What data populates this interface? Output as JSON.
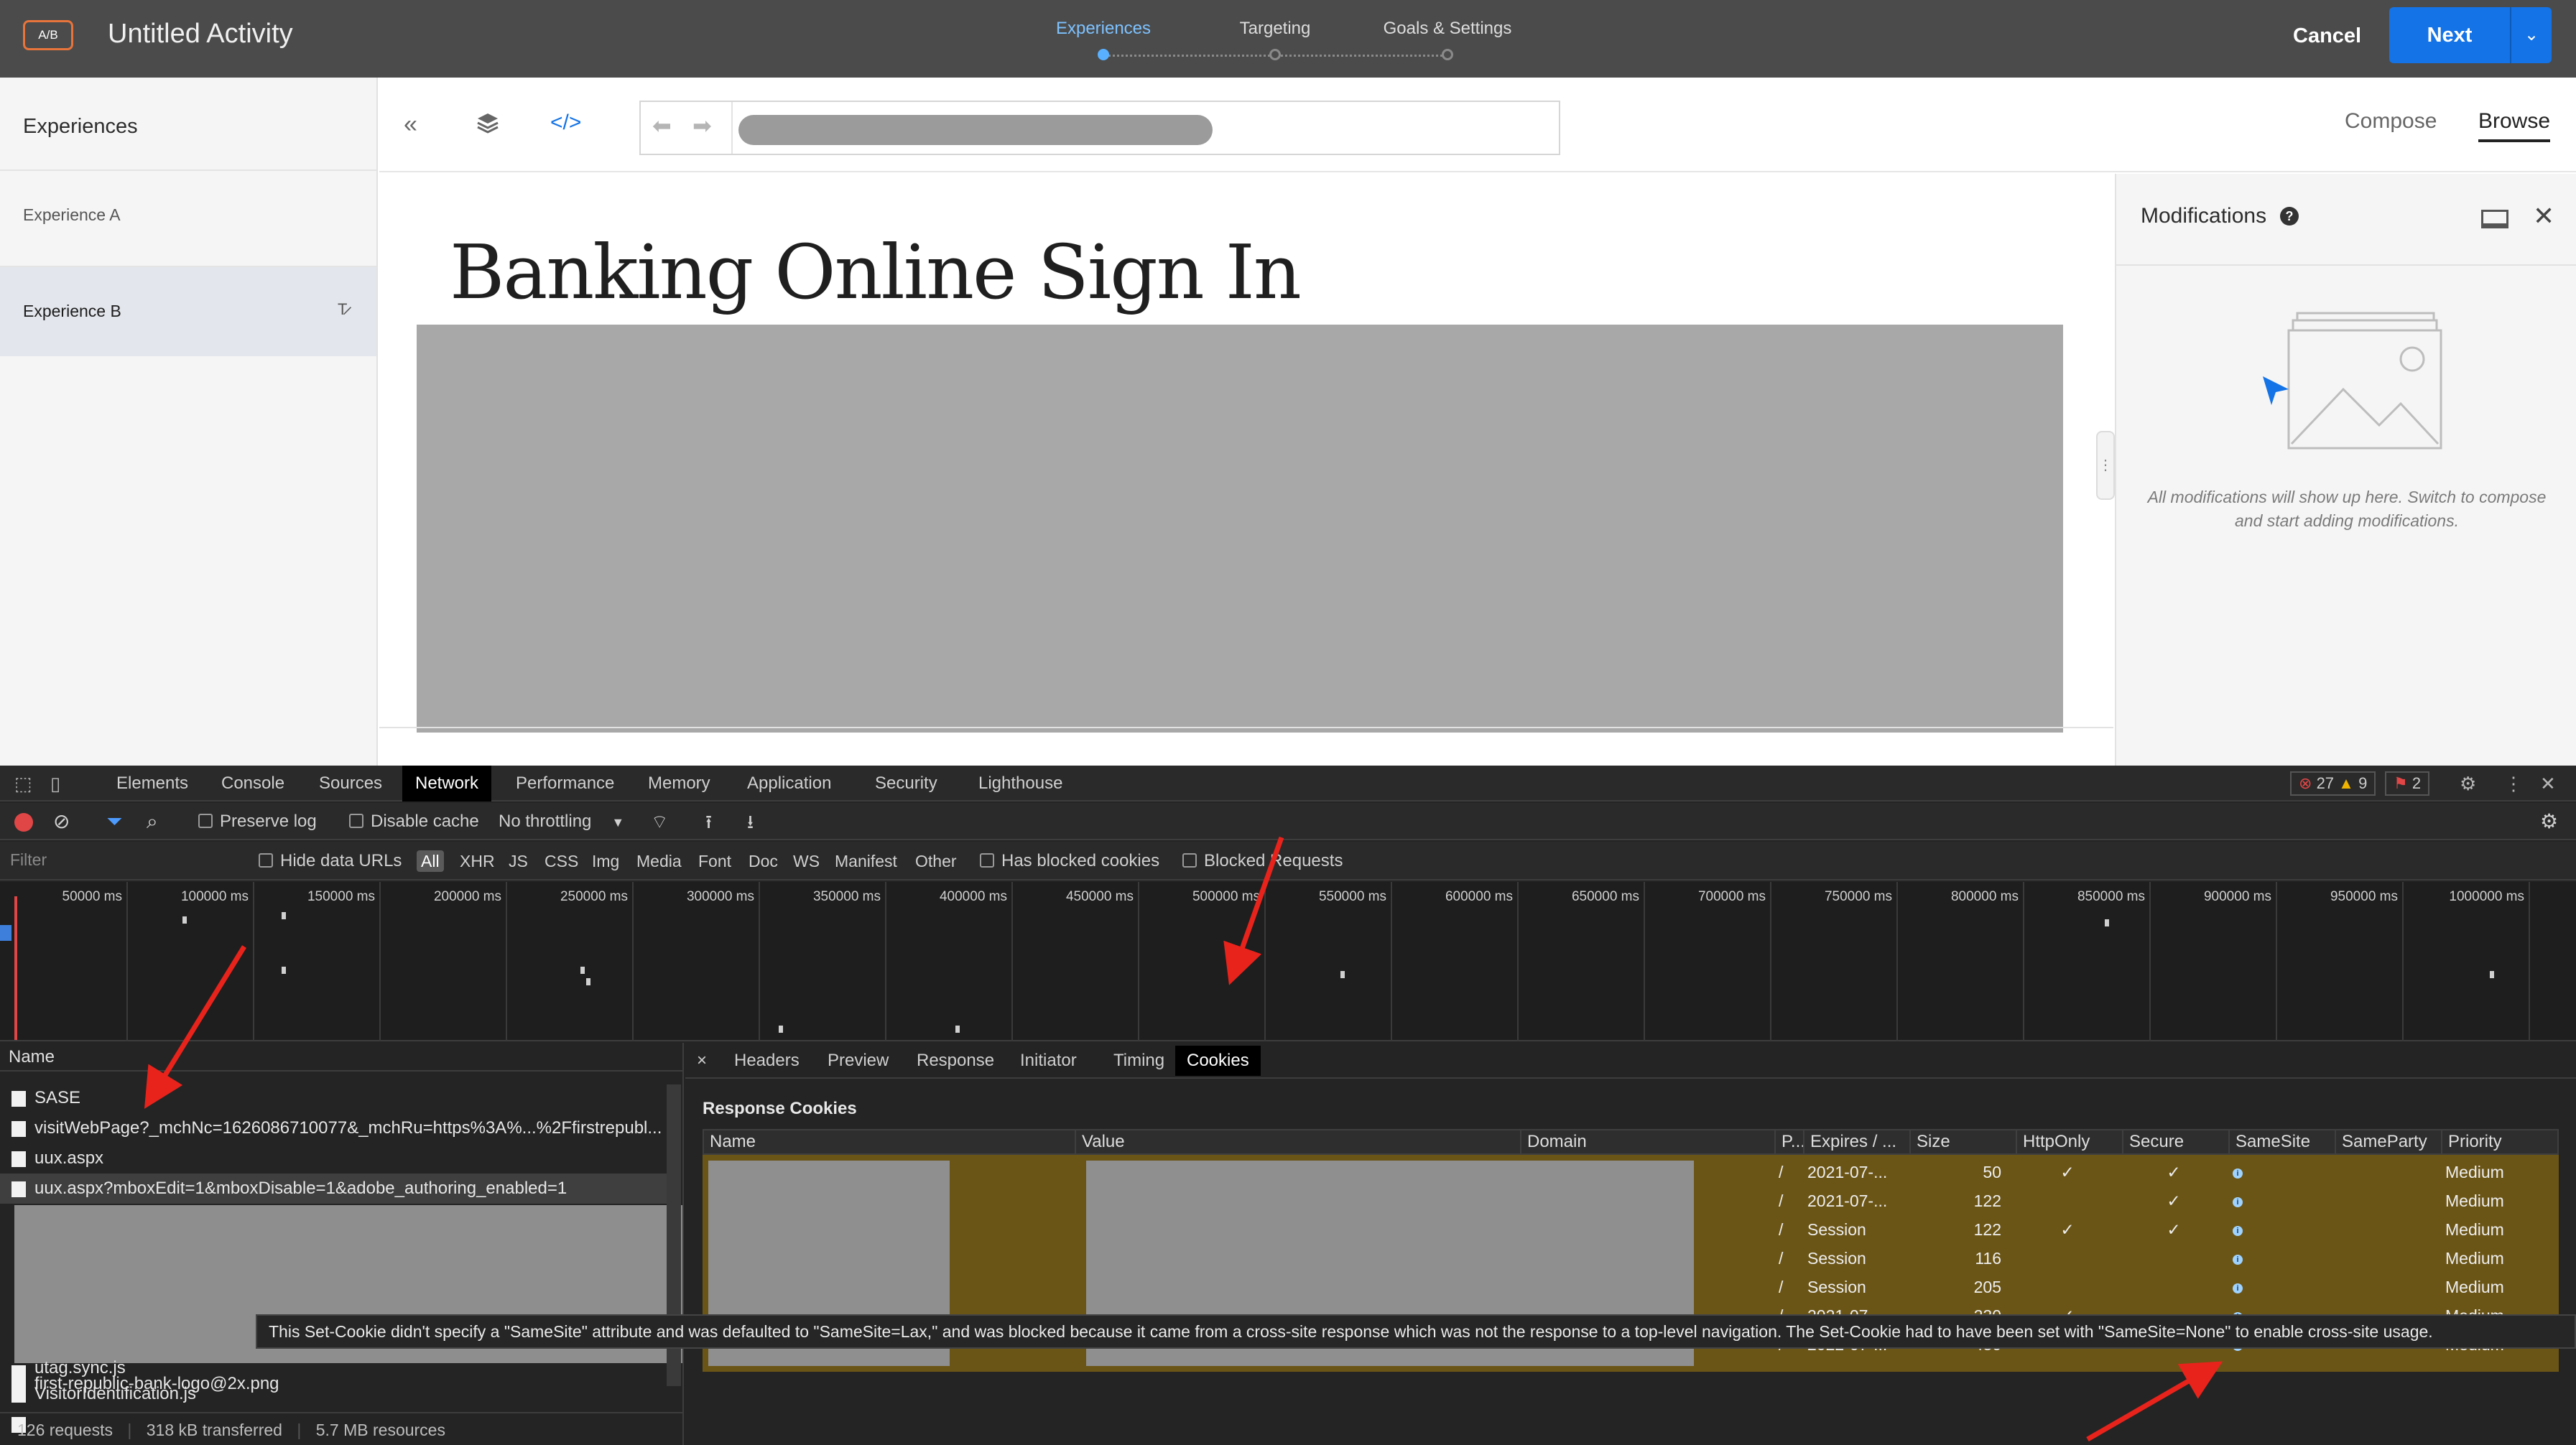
{
  "header": {
    "badge": "A/B",
    "title": "Untitled Activity",
    "steps": [
      {
        "label": "Experiences",
        "active": true
      },
      {
        "label": "Targeting",
        "active": false
      },
      {
        "label": "Goals & Settings",
        "active": false
      }
    ],
    "cancel_label": "Cancel",
    "next_label": "Next",
    "next_menu_icon": "chevron-down-icon"
  },
  "experiences": {
    "heading": "Experiences",
    "items": [
      {
        "label": "Experience A",
        "selected": false
      },
      {
        "label": "Experience B",
        "selected": true
      }
    ]
  },
  "toolbar": {
    "collapse_icon": "double-chevron-left-icon",
    "layers_icon": "layers-icon",
    "code_icon": "code-icon",
    "back_icon": "arrow-left-icon",
    "forward_icon": "arrow-right-icon",
    "modes": [
      {
        "label": "Compose",
        "active": false
      },
      {
        "label": "Browse",
        "active": true
      }
    ]
  },
  "page": {
    "heading": "Banking Online Sign In"
  },
  "modifications": {
    "title": "Modifications",
    "help": "?",
    "empty_text": "All modifications will show up here. Switch to compose and start adding modifications."
  },
  "devtools": {
    "tabs": [
      {
        "label": "Elements",
        "active": false
      },
      {
        "label": "Console",
        "active": false
      },
      {
        "label": "Sources",
        "active": false
      },
      {
        "label": "Network",
        "active": true
      },
      {
        "label": "Performance",
        "active": false
      },
      {
        "label": "Memory",
        "active": false
      },
      {
        "label": "Application",
        "active": false
      },
      {
        "label": "Security",
        "active": false
      },
      {
        "label": "Lighthouse",
        "active": false
      }
    ],
    "errors": "27",
    "warnings": "9",
    "issues": "2",
    "toolbar": {
      "preserve_log": "Preserve log",
      "disable_cache": "Disable cache",
      "throttling": "No throttling"
    },
    "filter": {
      "placeholder": "Filter",
      "hide_data_urls": "Hide data URLs",
      "types": [
        "All",
        "XHR",
        "JS",
        "CSS",
        "Img",
        "Media",
        "Font",
        "Doc",
        "WS",
        "Manifest",
        "Other"
      ],
      "active_type": "All",
      "has_blocked_cookies": "Has blocked cookies",
      "blocked_requests": "Blocked Requests"
    },
    "timeline_ticks": [
      "50000 ms",
      "100000 ms",
      "150000 ms",
      "200000 ms",
      "250000 ms",
      "300000 ms",
      "350000 ms",
      "400000 ms",
      "450000 ms",
      "500000 ms",
      "550000 ms",
      "600000 ms",
      "650000 ms",
      "700000 ms",
      "750000 ms",
      "800000 ms",
      "850000 ms",
      "900000 ms",
      "950000 ms",
      "1000000 ms"
    ],
    "requests": {
      "column": "Name",
      "rows": [
        {
          "name": "SASE",
          "selected": false
        },
        {
          "name": "visitWebPage?_mchNc=1626086710077&_mchRu=https%3A%...%2Ffirstrepubl...",
          "selected": false
        },
        {
          "name": "uux.aspx",
          "selected": false
        },
        {
          "name": "uux.aspx?mboxEdit=1&mboxDisable=1&adobe_authoring_enabled=1",
          "selected": true
        },
        {
          "name": "utag.sync.js",
          "selected": false
        },
        {
          "name": "VisitorIdentification.js",
          "selected": false
        },
        {
          "name": "first-republic-bank-logo@2x.png",
          "selected": false
        }
      ],
      "status": {
        "requests": "126 requests",
        "transferred": "318 kB transferred",
        "resources": "5.7 MB resources"
      }
    },
    "detail": {
      "close": "×",
      "tabs": [
        {
          "label": "Headers",
          "active": false
        },
        {
          "label": "Preview",
          "active": false
        },
        {
          "label": "Response",
          "active": false
        },
        {
          "label": "Initiator",
          "active": false
        },
        {
          "label": "Timing",
          "active": false
        },
        {
          "label": "Cookies",
          "active": true
        }
      ],
      "section_title": "Response Cookies",
      "columns": [
        "Name",
        "Value",
        "Domain",
        "P...",
        "Expires / ...",
        "Size",
        "HttpOnly",
        "Secure",
        "SameSite",
        "SameParty",
        "Priority"
      ],
      "rows": [
        {
          "path": "/",
          "expires": "2021-07-...",
          "size": "50",
          "httponly": "✓",
          "secure": "✓",
          "priority": "Medium"
        },
        {
          "path": "/",
          "expires": "2021-07-...",
          "size": "122",
          "httponly": "",
          "secure": "✓",
          "priority": "Medium"
        },
        {
          "path": "/",
          "expires": "Session",
          "size": "122",
          "httponly": "✓",
          "secure": "✓",
          "priority": "Medium"
        },
        {
          "path": "/",
          "expires": "Session",
          "size": "116",
          "httponly": "",
          "secure": "",
          "priority": "Medium"
        },
        {
          "path": "/",
          "expires": "Session",
          "size": "205",
          "httponly": "",
          "secure": "",
          "priority": "Medium"
        },
        {
          "path": "/",
          "expires": "2021-07-...",
          "size": "230",
          "httponly": "✓",
          "secure": "",
          "priority": "Medium"
        },
        {
          "path": "/",
          "expires": "2022-07-...",
          "size": "430",
          "httponly": "",
          "secure": "✓",
          "priority": "Medium"
        }
      ],
      "samesite_icon": "info-icon"
    },
    "tooltip": "This Set-Cookie didn't specify a \"SameSite\" attribute and was defaulted to \"SameSite=Lax,\" and was blocked because it came from a cross-site response which was not the response to a top-level navigation. The Set-Cookie had to have been set with \"SameSite=None\" to enable cross-site usage."
  },
  "colors": {
    "header_bg": "#4b4b4b",
    "accent_blue": "#1473e6",
    "ab_badge_orange": "#e8743b",
    "devtools_bg": "#242424",
    "cookie_row_highlight": "#6b5516",
    "annotation_red": "#e8231c"
  }
}
